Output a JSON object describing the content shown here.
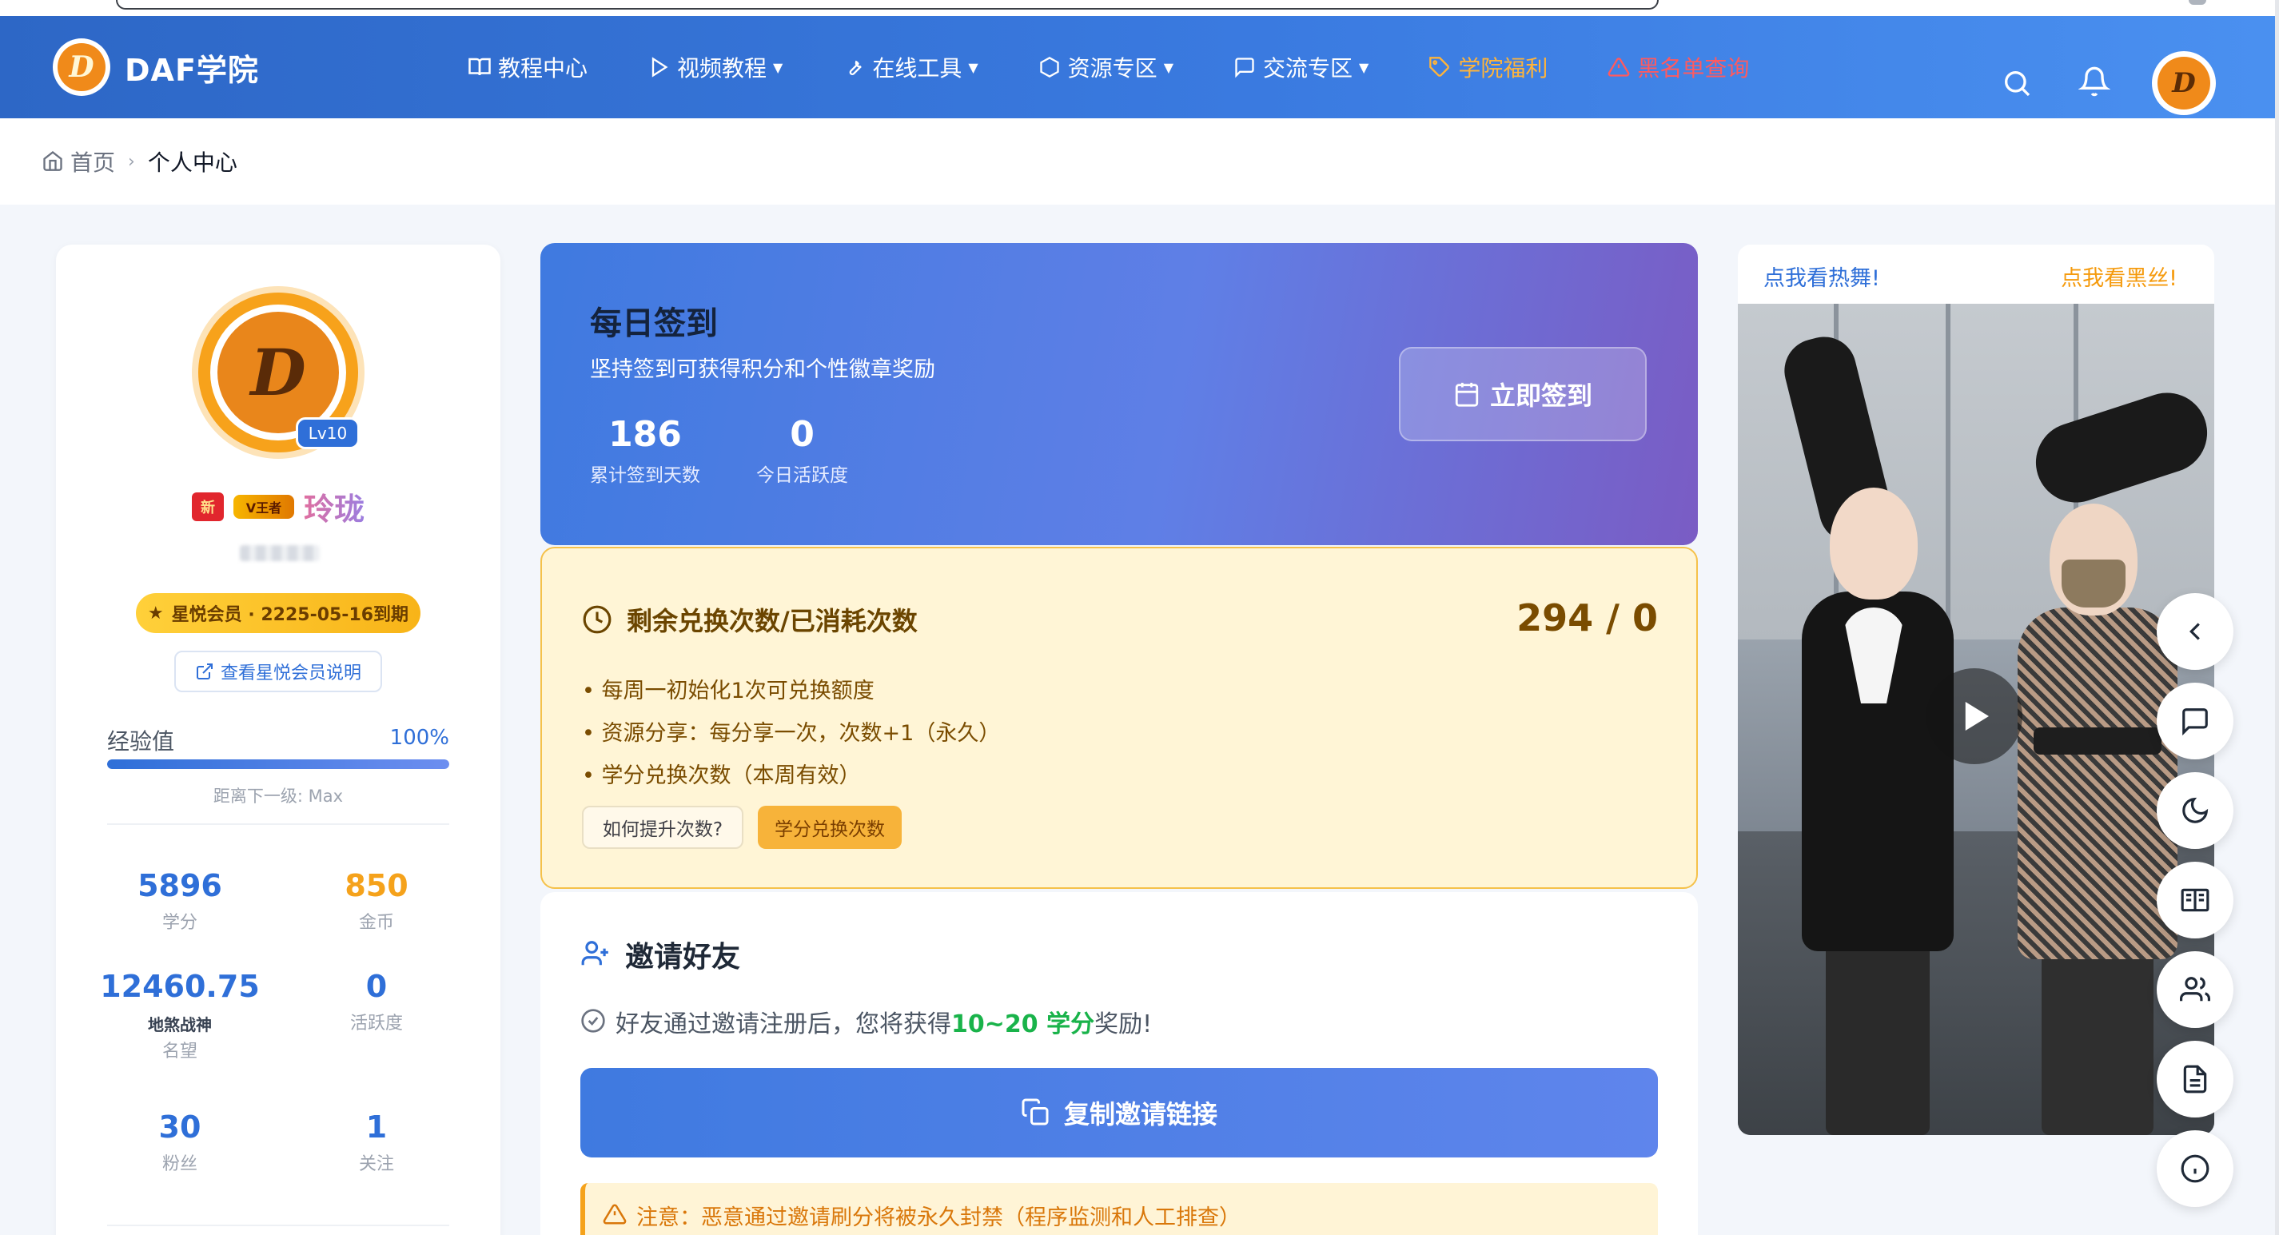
{
  "header": {
    "brand": "DAF学院",
    "nav": [
      {
        "label": "教程中心",
        "icon": "book-icon",
        "has_dropdown": false,
        "style": "normal"
      },
      {
        "label": "视频教程",
        "icon": "play-icon",
        "has_dropdown": true,
        "style": "normal"
      },
      {
        "label": "在线工具",
        "icon": "wrench-icon",
        "has_dropdown": true,
        "style": "normal"
      },
      {
        "label": "资源专区",
        "icon": "hexagon-icon",
        "has_dropdown": true,
        "style": "normal"
      },
      {
        "label": "交流专区",
        "icon": "chat-icon",
        "has_dropdown": true,
        "style": "normal"
      },
      {
        "label": "学院福利",
        "icon": "tag-icon",
        "has_dropdown": false,
        "style": "gold"
      },
      {
        "label": "黑名单查询",
        "icon": "warning-icon",
        "has_dropdown": false,
        "style": "red"
      }
    ],
    "caret": "▼",
    "logo_letter": "D"
  },
  "breadcrumb": {
    "home": "首页",
    "separator": "›",
    "current": "个人中心"
  },
  "profile": {
    "level": "Lv10",
    "medal1": "新",
    "medal2": "V王者",
    "username": "玲珑",
    "vip_star": "★",
    "vip_text": "星悦会员 · 2225-05-16到期",
    "vip_link": "查看星悦会员说明",
    "exp_label": "经验值",
    "exp_percent_text": "100%",
    "exp_progress": 1.0,
    "exp_next": "距离下一级: Max",
    "stats": [
      {
        "value": "5896",
        "label": "学分",
        "color": "blue"
      },
      {
        "value": "850",
        "label": "金币",
        "color": "orange"
      },
      {
        "value": "12460.75",
        "title": "地煞战神",
        "label": "名望",
        "color": "blue"
      },
      {
        "value": "0",
        "label": "活跃度",
        "color": "blue"
      },
      {
        "value": "30",
        "label": "粉丝",
        "color": "blue"
      },
      {
        "value": "1",
        "label": "关注",
        "color": "blue"
      }
    ]
  },
  "signin": {
    "title": "每日签到",
    "desc": "坚持签到可获得积分和个性徽章奖励",
    "total_days": "186",
    "total_days_label": "累计签到天数",
    "today_activity": "0",
    "today_activity_label": "今日活跃度",
    "button": "立即签到"
  },
  "exchange": {
    "title": "剩余兑换次数/已消耗次数",
    "count": "294 / 0",
    "items": [
      "每周一初始化1次可兑换额度",
      "资源分享：每分享一次，次数+1（永久）",
      "学分兑换次数（本周有效）"
    ],
    "btn_help": "如何提升次数?",
    "btn_exchange": "学分兑换次数"
  },
  "invite": {
    "title": "邀请好友",
    "desc_prefix": "好友通过邀请注册后，您将获得",
    "desc_reward": "10~20 学分",
    "desc_suffix": "奖励!",
    "button": "复制邀请链接",
    "warning": "注意：恶意通过邀请刷分将被永久封禁（程序监测和人工排查）"
  },
  "promo": {
    "link_a": "点我看热舞!",
    "link_b": "点我看黑丝!"
  },
  "float_buttons": [
    "chevron-left-icon",
    "message-icon",
    "moon-icon",
    "book-open-icon",
    "users-icon",
    "document-icon",
    "info-icon"
  ],
  "colors": {
    "primary": "#2f6fd8",
    "gold": "#ffb43a",
    "red": "#ff5a5f",
    "orange": "#f5a21b",
    "green": "#19b34a"
  }
}
